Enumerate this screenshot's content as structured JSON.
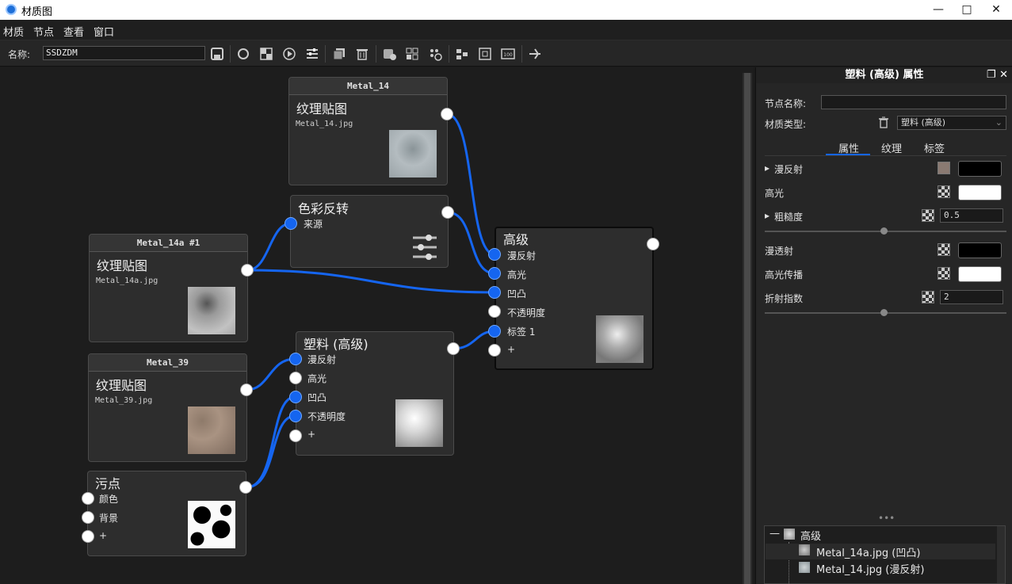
{
  "window": {
    "title": "材质图"
  },
  "menu": [
    "材质",
    "节点",
    "查看",
    "窗口"
  ],
  "toolbar": {
    "name_label": "名称:",
    "name_value": "SSDZDM"
  },
  "nodes": {
    "metal14": {
      "header": "Metal_14",
      "title": "纹理贴图",
      "file": "Metal_14.jpg"
    },
    "invert": {
      "title": "色彩反转",
      "ports": [
        "来源"
      ]
    },
    "metal14a": {
      "header": "Metal_14a #1",
      "title": "纹理贴图",
      "file": "Metal_14a.jpg"
    },
    "advanced": {
      "title": "高级",
      "ports": [
        "漫反射",
        "高光",
        "凹凸",
        "不透明度",
        "标签 1",
        "+"
      ]
    },
    "metal39": {
      "header": "Metal_39",
      "title": "纹理贴图",
      "file": "Metal_39.jpg"
    },
    "plastic": {
      "title": "塑料 (高级)",
      "ports": [
        "漫反射",
        "高光",
        "凹凸",
        "不透明度",
        "+"
      ]
    },
    "dirt": {
      "title": "污点",
      "ports": [
        "颜色",
        "背景",
        "+"
      ]
    }
  },
  "panel": {
    "title": "塑料 (高级) 属性",
    "node_name_label": "节点名称:",
    "node_name_value": "",
    "material_type_label": "材质类型:",
    "material_type_value": "塑料 (高级)",
    "tabs": [
      "属性",
      "纹理",
      "标签"
    ],
    "props": {
      "diffuse": "漫反射",
      "specular": "高光",
      "roughness": "粗糙度",
      "roughness_value": "0.5",
      "translucency": "漫透射",
      "spec_trans": "高光传播",
      "ior": "折射指数",
      "ior_value": "2"
    },
    "colors": {
      "diffuse": "#000000",
      "specular": "#ffffff",
      "translucency": "#000000",
      "spec_trans": "#ffffff"
    },
    "tree": [
      {
        "label": "高级"
      },
      {
        "label": "Metal_14a.jpg (凹凸)"
      },
      {
        "label": "Metal_14.jpg (漫反射)"
      }
    ]
  },
  "accent": "#1565f0"
}
